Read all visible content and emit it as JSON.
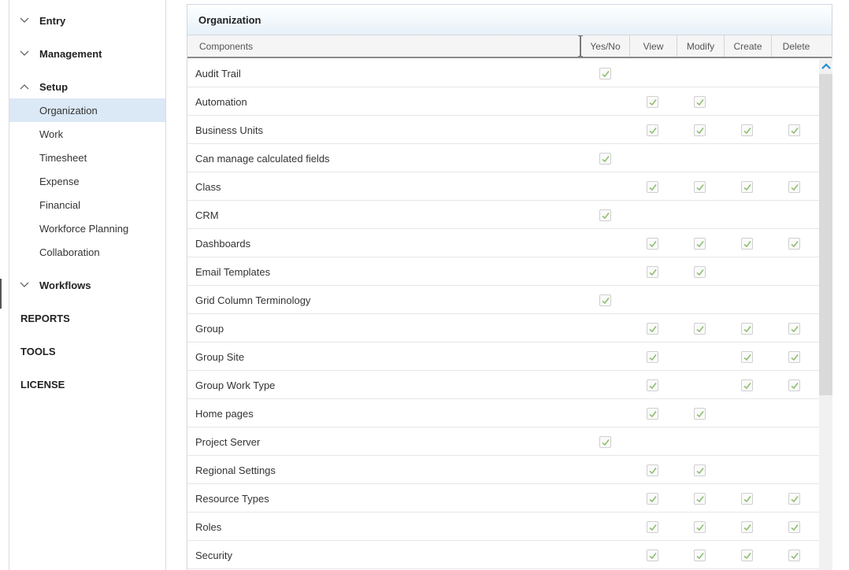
{
  "sidebar": {
    "groups": [
      {
        "label": "Entry"
      },
      {
        "label": "Management"
      },
      {
        "label": "Setup"
      },
      {
        "label": "Workflows"
      }
    ],
    "setup_items": [
      {
        "label": "Organization",
        "active": true
      },
      {
        "label": "Work"
      },
      {
        "label": "Timesheet"
      },
      {
        "label": "Expense"
      },
      {
        "label": "Financial"
      },
      {
        "label": "Workforce Planning"
      },
      {
        "label": "Collaboration"
      }
    ],
    "top_items": [
      {
        "label": "REPORTS"
      },
      {
        "label": "TOOLS"
      },
      {
        "label": "LICENSE"
      }
    ]
  },
  "panel": {
    "title": "Organization",
    "columns": {
      "components": "Components",
      "yes_no": "Yes/No",
      "view": "View",
      "modify": "Modify",
      "create": "Create",
      "delete": "Delete"
    },
    "rows": [
      {
        "name": "Audit Trail",
        "yes_no": true,
        "view": false,
        "modify": false,
        "create": false,
        "delete": false
      },
      {
        "name": "Automation",
        "yes_no": false,
        "view": true,
        "modify": true,
        "create": false,
        "delete": false
      },
      {
        "name": "Business Units",
        "yes_no": false,
        "view": true,
        "modify": true,
        "create": true,
        "delete": true
      },
      {
        "name": "Can manage calculated fields",
        "yes_no": true,
        "view": false,
        "modify": false,
        "create": false,
        "delete": false
      },
      {
        "name": "Class",
        "yes_no": false,
        "view": true,
        "modify": true,
        "create": true,
        "delete": true
      },
      {
        "name": "CRM",
        "yes_no": true,
        "view": false,
        "modify": false,
        "create": false,
        "delete": false
      },
      {
        "name": "Dashboards",
        "yes_no": false,
        "view": true,
        "modify": true,
        "create": true,
        "delete": true
      },
      {
        "name": "Email Templates",
        "yes_no": false,
        "view": true,
        "modify": true,
        "create": false,
        "delete": false
      },
      {
        "name": "Grid Column Terminology",
        "yes_no": true,
        "view": false,
        "modify": false,
        "create": false,
        "delete": false
      },
      {
        "name": "Group",
        "yes_no": false,
        "view": true,
        "modify": true,
        "create": true,
        "delete": true
      },
      {
        "name": "Group Site",
        "yes_no": false,
        "view": true,
        "modify": false,
        "create": true,
        "delete": true
      },
      {
        "name": "Group Work Type",
        "yes_no": false,
        "view": true,
        "modify": false,
        "create": true,
        "delete": true
      },
      {
        "name": "Home pages",
        "yes_no": false,
        "view": true,
        "modify": true,
        "create": false,
        "delete": false
      },
      {
        "name": "Project Server",
        "yes_no": true,
        "view": false,
        "modify": false,
        "create": false,
        "delete": false
      },
      {
        "name": "Regional Settings",
        "yes_no": false,
        "view": true,
        "modify": true,
        "create": false,
        "delete": false
      },
      {
        "name": "Resource Types",
        "yes_no": false,
        "view": true,
        "modify": true,
        "create": true,
        "delete": true
      },
      {
        "name": "Roles",
        "yes_no": false,
        "view": true,
        "modify": true,
        "create": true,
        "delete": true
      },
      {
        "name": "Security",
        "yes_no": false,
        "view": true,
        "modify": true,
        "create": true,
        "delete": true
      }
    ]
  },
  "colors": {
    "active_bg": "#dbe8f5",
    "check_color": "#8fbf6f",
    "scroll_arrow": "#1f8fd6"
  }
}
